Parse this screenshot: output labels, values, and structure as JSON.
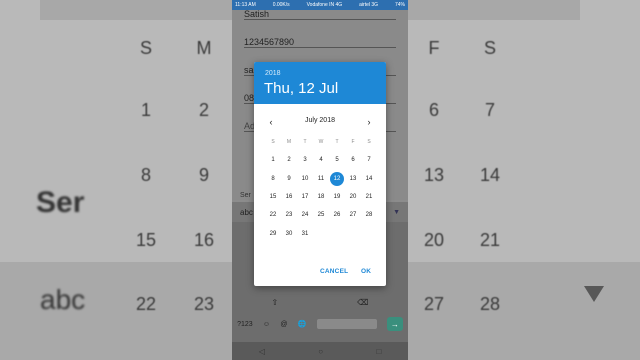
{
  "background": {
    "weekday_letters": [
      "S",
      "M",
      "F",
      "S"
    ],
    "rows": [
      [
        "1",
        "2",
        "6",
        "7"
      ],
      [
        "8",
        "9",
        "13",
        "14"
      ],
      [
        "15",
        "16",
        "20",
        "21"
      ],
      [
        "22",
        "23",
        "27",
        "28"
      ]
    ],
    "section_text": "Ser",
    "keyboard_text": "abc"
  },
  "status_bar": {
    "time": "11:13 AM",
    "speed": "0.00K/s",
    "carrier1": "Vodafone IN 4G",
    "carrier2": "airtel 3G",
    "battery": "74%"
  },
  "form": {
    "name_value": "Satish",
    "phone_value": "1234567890",
    "partial_value": "sa",
    "date_value": "08",
    "partial_placeholder": "Ad",
    "section_label": "Ser"
  },
  "keyboard": {
    "suggestion": "abc",
    "row_symbols": [
      "⇧",
      "⌫"
    ],
    "bottom_keys": [
      "?123",
      "☺",
      "@",
      "🌐"
    ]
  },
  "date_picker": {
    "header_year": "2018",
    "header_date": "Thu, 12 Jul",
    "month_title": "July 2018",
    "weekdays": [
      "S",
      "M",
      "T",
      "W",
      "T",
      "F",
      "S"
    ],
    "weeks": [
      [
        "1",
        "2",
        "3",
        "4",
        "5",
        "6",
        "7"
      ],
      [
        "8",
        "9",
        "10",
        "11",
        "12",
        "13",
        "14"
      ],
      [
        "15",
        "16",
        "17",
        "18",
        "19",
        "20",
        "21"
      ],
      [
        "22",
        "23",
        "24",
        "25",
        "26",
        "27",
        "28"
      ],
      [
        "29",
        "30",
        "31",
        "",
        "",
        "",
        ""
      ]
    ],
    "selected_day": "12",
    "cancel_label": "CANCEL",
    "ok_label": "OK",
    "accent_color": "#1e88d6"
  }
}
